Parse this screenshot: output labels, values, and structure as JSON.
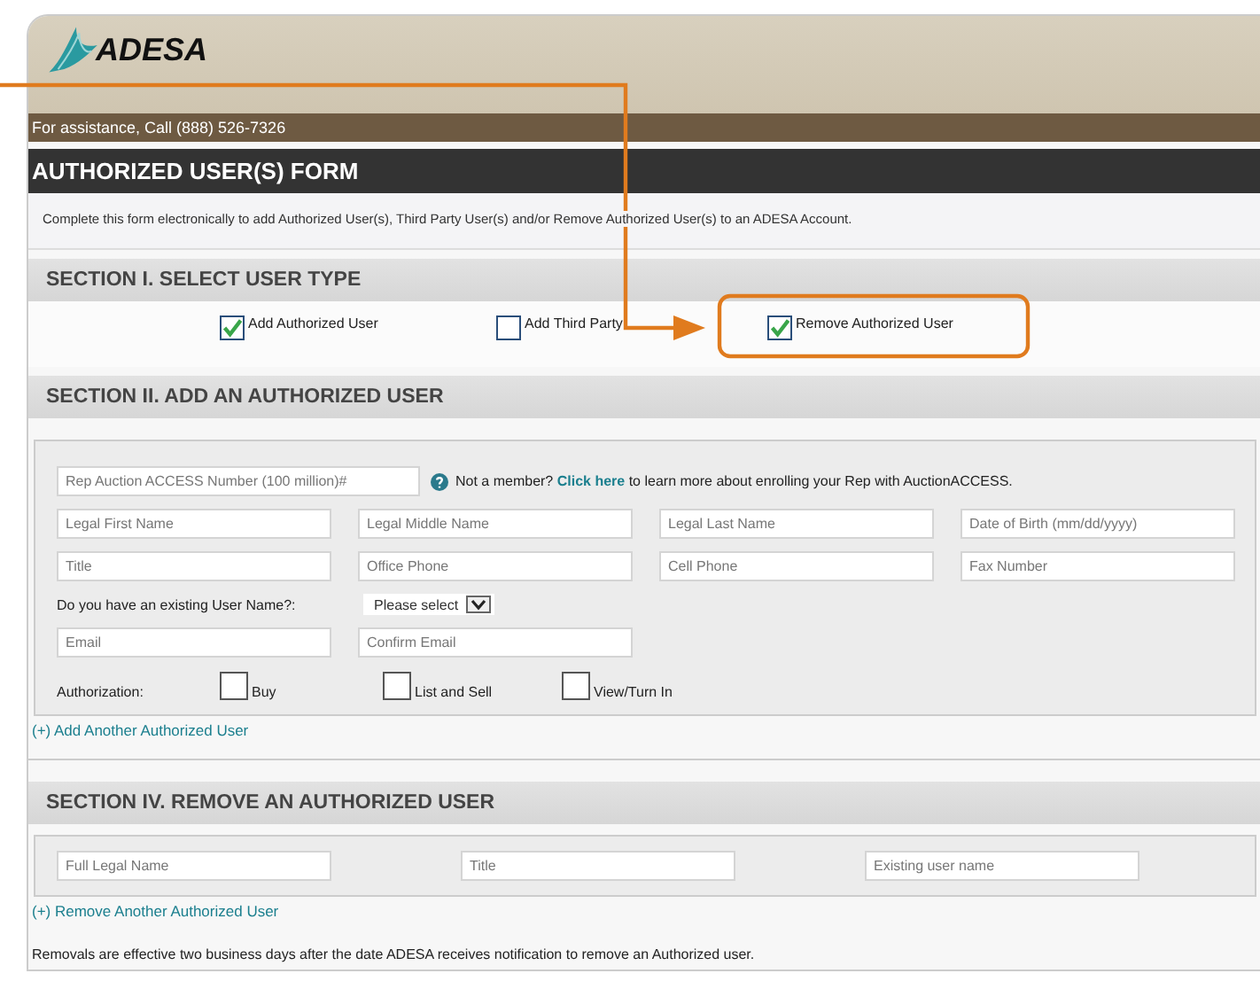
{
  "logo": {
    "text": "ADESA"
  },
  "assistance": "For assistance, Call (888) 526-7326",
  "form_title": "AUTHORIZED USER(S) FORM",
  "intro": "Complete this form electronically to add Authorized User(s), Third Party User(s) and/or Remove Authorized User(s) to an ADESA Account.",
  "section_1": {
    "title": "SECTION I. SELECT USER TYPE",
    "options": [
      {
        "label": "Add Authorized User",
        "checked": true
      },
      {
        "label": "Add Third Party",
        "checked": false
      },
      {
        "label": "Remove Authorized User",
        "checked": true
      }
    ]
  },
  "section_2": {
    "title": "SECTION II. ADD AN AUTHORIZED USER",
    "rep_field": {
      "placeholder": "Rep Auction ACCESS Number (100 million)#"
    },
    "member_note": {
      "text": "Not a member?",
      "link": "Click here",
      "rest": "to learn more about enrolling your Rep with AuctionACCESS."
    },
    "fields": [
      {
        "placeholder": "Legal First Name"
      },
      {
        "placeholder": "Legal Middle Name"
      },
      {
        "placeholder": "Legal Last Name"
      },
      {
        "placeholder": "Date of Birth (mm/dd/yyyy)"
      },
      {
        "placeholder": "Title"
      },
      {
        "placeholder": "Office Phone"
      },
      {
        "placeholder": "Cell Phone"
      },
      {
        "placeholder": "Fax Number"
      }
    ],
    "username_question": "Do you have an existing User Name?:",
    "username_select": "Please select",
    "email_fields": [
      {
        "placeholder": "Email"
      },
      {
        "placeholder": "Confirm Email"
      }
    ],
    "authorization_label": "Authorization:",
    "authorization_options": [
      {
        "label": "Buy",
        "checked": false
      },
      {
        "label": "List and Sell",
        "checked": false
      },
      {
        "label": "View/Turn In",
        "checked": false
      }
    ],
    "add_link": "(+) Add Another Authorized User"
  },
  "section_4": {
    "title": "SECTION IV. REMOVE AN AUTHORIZED USER",
    "fields": [
      {
        "placeholder": "Full Legal Name"
      },
      {
        "placeholder": "Title"
      },
      {
        "placeholder": "Existing user name"
      }
    ],
    "remove_link": "(+) Remove Another Authorized User"
  },
  "note": "Removals are effective two business days after the date ADESA receives notification to remove an Authorized user."
}
